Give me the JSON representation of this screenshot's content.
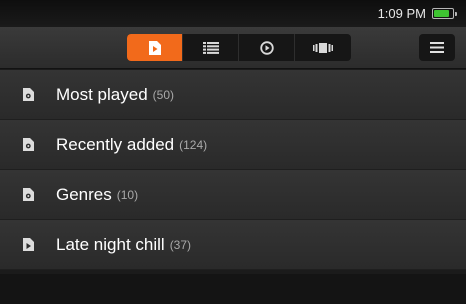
{
  "status_bar": {
    "time": "1:09 PM",
    "battery_level": 0.85,
    "battery_color": "#3ec431"
  },
  "toolbar": {
    "tabs": [
      {
        "icon": "playlist-file-icon",
        "active": true
      },
      {
        "icon": "list-view-icon",
        "active": false
      },
      {
        "icon": "play-circle-icon",
        "active": false
      },
      {
        "icon": "cover-flow-icon",
        "active": false
      }
    ],
    "active_color": "#f26a1b",
    "menu_icon": "hamburger-menu-icon"
  },
  "playlists": [
    {
      "title": "Most played",
      "count": "(50)",
      "icon": "smart-playlist-icon"
    },
    {
      "title": "Recently added",
      "count": "(124)",
      "icon": "smart-playlist-icon"
    },
    {
      "title": "Genres",
      "count": "(10)",
      "icon": "smart-playlist-icon"
    },
    {
      "title": "Late night chill",
      "count": "(37)",
      "icon": "playlist-icon"
    }
  ]
}
